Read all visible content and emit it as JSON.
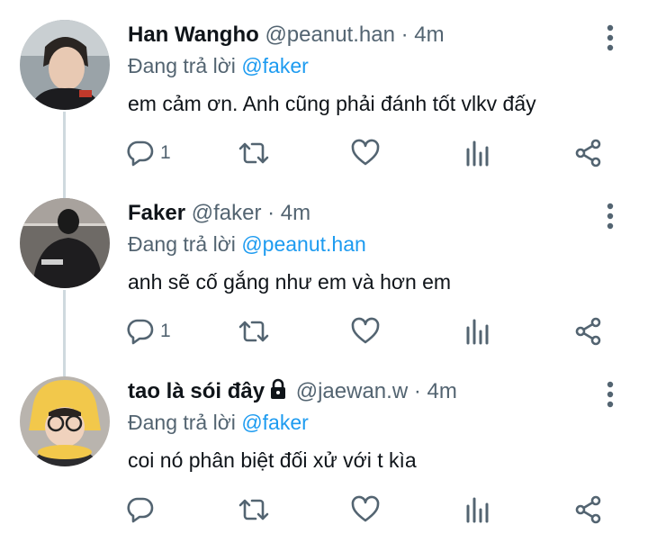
{
  "tweets": [
    {
      "name": "Han Wangho",
      "handle": "@peanut.han",
      "separator": "·",
      "time": "4m",
      "reply_prefix": "Đang trả lời",
      "reply_to": "@faker",
      "text": "em cảm ơn. Anh cũng phải đánh tốt vlkv đấy",
      "reply_count": "1",
      "locked": false
    },
    {
      "name": "Faker",
      "handle": "@faker",
      "separator": "·",
      "time": "4m",
      "reply_prefix": "Đang trả lời",
      "reply_to": "@peanut.han",
      "text": "anh sẽ cố gắng như em và hơn em",
      "reply_count": "1",
      "locked": false
    },
    {
      "name": "tao là sói đây",
      "handle": "@jaewan.w",
      "separator": "·",
      "time": "4m",
      "reply_prefix": "Đang trả lời",
      "reply_to": "@faker",
      "text": "coi nó phân biệt đối xử với t kìa",
      "reply_count": "",
      "locked": true
    }
  ],
  "colors": {
    "text": "#0f1419",
    "secondary": "#536471",
    "mention": "#1d9bf0",
    "thread_line": "#cfd9de"
  },
  "icons": [
    "reply-icon",
    "retweet-icon",
    "like-icon",
    "analytics-icon",
    "share-icon",
    "more-icon",
    "lock-icon"
  ]
}
